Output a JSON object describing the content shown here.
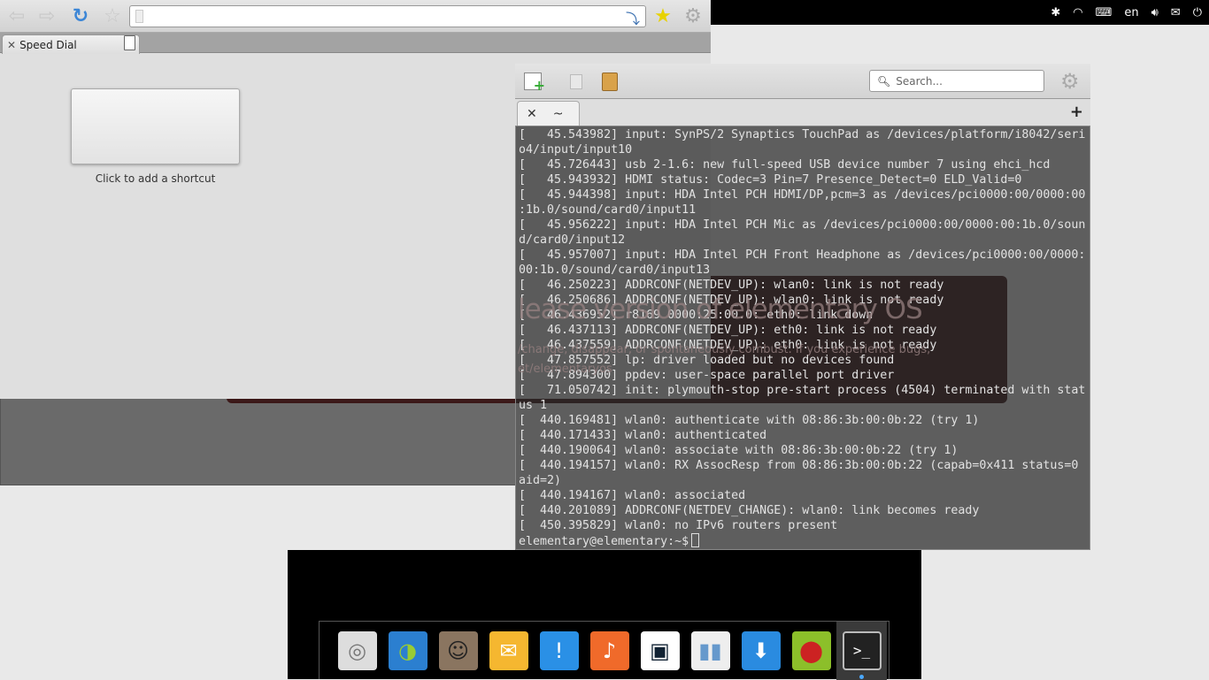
{
  "panel": {
    "language": "en",
    "icons": [
      "bluetooth-icon",
      "wifi-icon",
      "keyboard-icon",
      "volume-icon",
      "mail-icon",
      "power-icon"
    ]
  },
  "browser": {
    "tab_title": "Speed Dial",
    "url": "",
    "speed_dial": {
      "add_label": "Click to add a shortcut"
    }
  },
  "background_dialog": {
    "title_fragment": "lease version of elementary OS",
    "body_fragment": "/change, disappear, or spontaneously combust. If you experience bugs,",
    "link_fragment": "et/elementaryos"
  },
  "terminal": {
    "search_placeholder": "Search...",
    "tab_label": "~",
    "new_tab": "+",
    "lines": [
      "[   45.543982] input: SynPS/2 Synaptics TouchPad as /devices/platform/i8042/seri",
      "o4/input/input10",
      "[   45.726443] usb 2-1.6: new full-speed USB device number 7 using ehci_hcd",
      "[   45.943932] HDMI status: Codec=3 Pin=7 Presence_Detect=0 ELD_Valid=0",
      "[   45.944398] input: HDA Intel PCH HDMI/DP,pcm=3 as /devices/pci0000:00/0000:00",
      ":1b.0/sound/card0/input11",
      "[   45.956222] input: HDA Intel PCH Mic as /devices/pci0000:00/0000:00:1b.0/soun",
      "d/card0/input12",
      "[   45.957007] input: HDA Intel PCH Front Headphone as /devices/pci0000:00/0000:",
      "00:1b.0/sound/card0/input13",
      "[   46.250223] ADDRCONF(NETDEV_UP): wlan0: link is not ready",
      "[   46.250686] ADDRCONF(NETDEV_UP): wlan0: link is not ready",
      "[   46.436952] r8169 0000:25:00.0: eth0: link down",
      "[   46.437113] ADDRCONF(NETDEV_UP): eth0: link is not ready",
      "[   46.437559] ADDRCONF(NETDEV_UP): eth0: link is not ready",
      "[   47.857552] lp: driver loaded but no devices found",
      "[   47.894300] ppdev: user-space parallel port driver",
      "[   71.050742] init: plymouth-stop pre-start process (4504) terminated with stat",
      "us 1",
      "[  440.169481] wlan0: authenticate with 08:86:3b:00:0b:22 (try 1)",
      "[  440.171433] wlan0: authenticated",
      "[  440.190064] wlan0: associate with 08:86:3b:00:0b:22 (try 1)",
      "[  440.194157] wlan0: RX AssocResp from 08:86:3b:00:0b:22 (capab=0x411 status=0",
      "aid=2)",
      "[  440.194167] wlan0: associated",
      "[  440.201089] ADDRCONF(NETDEV_CHANGE): wlan0: link becomes ready",
      "[  450.395829] wlan0: no IPv6 routers present"
    ],
    "prompt": "elementary@elementary:~$"
  },
  "dock": {
    "items": [
      "disc-installer",
      "web-browser",
      "contacts",
      "mail",
      "chat",
      "music",
      "photos",
      "system-settings",
      "downloads",
      "bug-reporter",
      "terminal"
    ]
  }
}
